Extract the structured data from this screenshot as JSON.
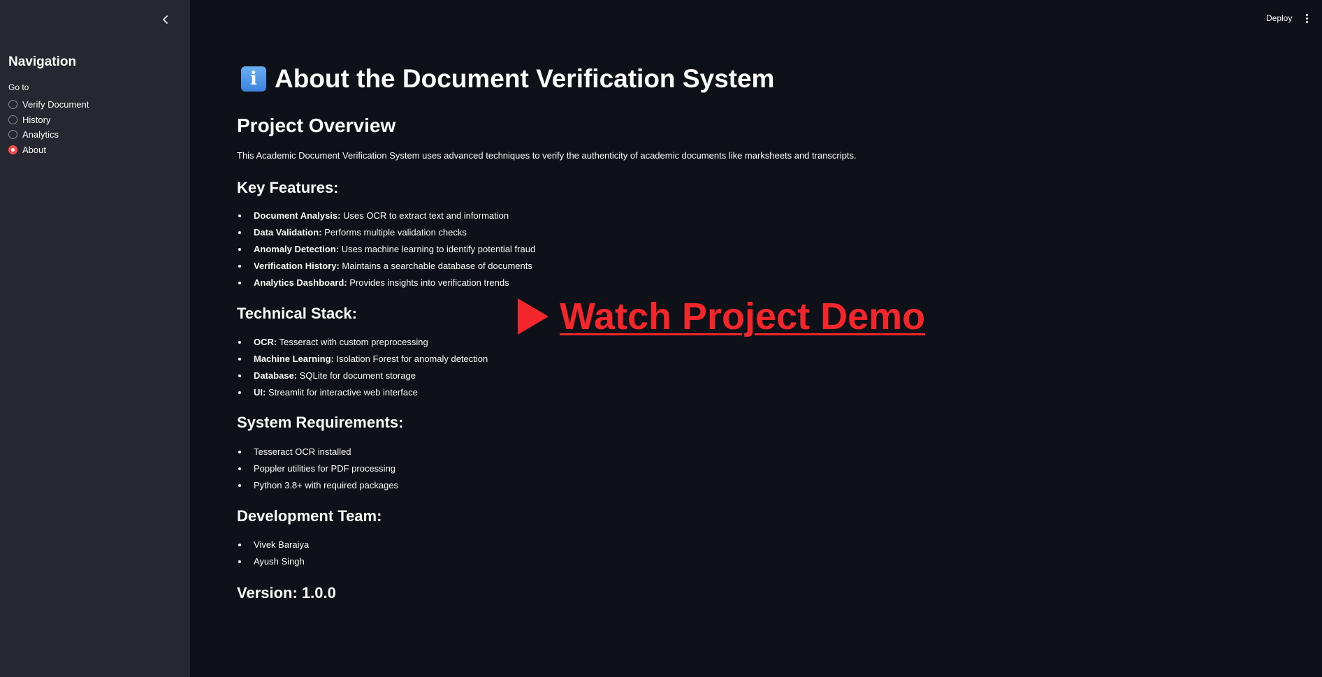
{
  "sidebar": {
    "collapse_icon": "chevron-left-icon",
    "title": "Navigation",
    "goto_label": "Go to",
    "options": [
      {
        "label": "Verify Document",
        "selected": false
      },
      {
        "label": "History",
        "selected": false
      },
      {
        "label": "Analytics",
        "selected": false
      },
      {
        "label": "About",
        "selected": true
      }
    ]
  },
  "toolbar": {
    "deploy_label": "Deploy",
    "menu_icon": "kebab-menu-icon"
  },
  "main": {
    "title_icon": "info-icon",
    "title_icon_glyph": "i",
    "title": "About the Document Verification System",
    "overview_heading": "Project Overview",
    "overview_text": "This Academic Document Verification System uses advanced techniques to verify the authenticity of academic documents like marksheets and transcripts.",
    "features_heading": "Key Features:",
    "features": [
      {
        "bold": "Document Analysis:",
        "text": " Uses OCR to extract text and information"
      },
      {
        "bold": "Data Validation:",
        "text": " Performs multiple validation checks"
      },
      {
        "bold": "Anomaly Detection:",
        "text": " Uses machine learning to identify potential fraud"
      },
      {
        "bold": "Verification History:",
        "text": " Maintains a searchable database of documents"
      },
      {
        "bold": "Analytics Dashboard:",
        "text": " Provides insights into verification trends"
      }
    ],
    "stack_heading": "Technical Stack:",
    "stack": [
      {
        "bold": "OCR:",
        "text": " Tesseract with custom preprocessing"
      },
      {
        "bold": "Machine Learning:",
        "text": " Isolation Forest for anomaly detection"
      },
      {
        "bold": "Database:",
        "text": " SQLite for document storage"
      },
      {
        "bold": "UI:",
        "text": " Streamlit for interactive web interface"
      }
    ],
    "requirements_heading": "System Requirements:",
    "requirements": [
      "Tesseract OCR installed",
      "Poppler utilities for PDF processing",
      "Python 3.8+ with required packages"
    ],
    "team_heading": "Development Team:",
    "team": [
      "Vivek Baraiya",
      "Ayush Singh"
    ],
    "version": "Version: 1.0.0",
    "demo_link_label": "Watch Project Demo",
    "demo_icon": "play-icon"
  },
  "colors": {
    "background": "#0e1117",
    "sidebar_background": "#262730",
    "accent": "#ff4b4b",
    "demo_link": "#f2262b",
    "text": "#fafafa"
  }
}
